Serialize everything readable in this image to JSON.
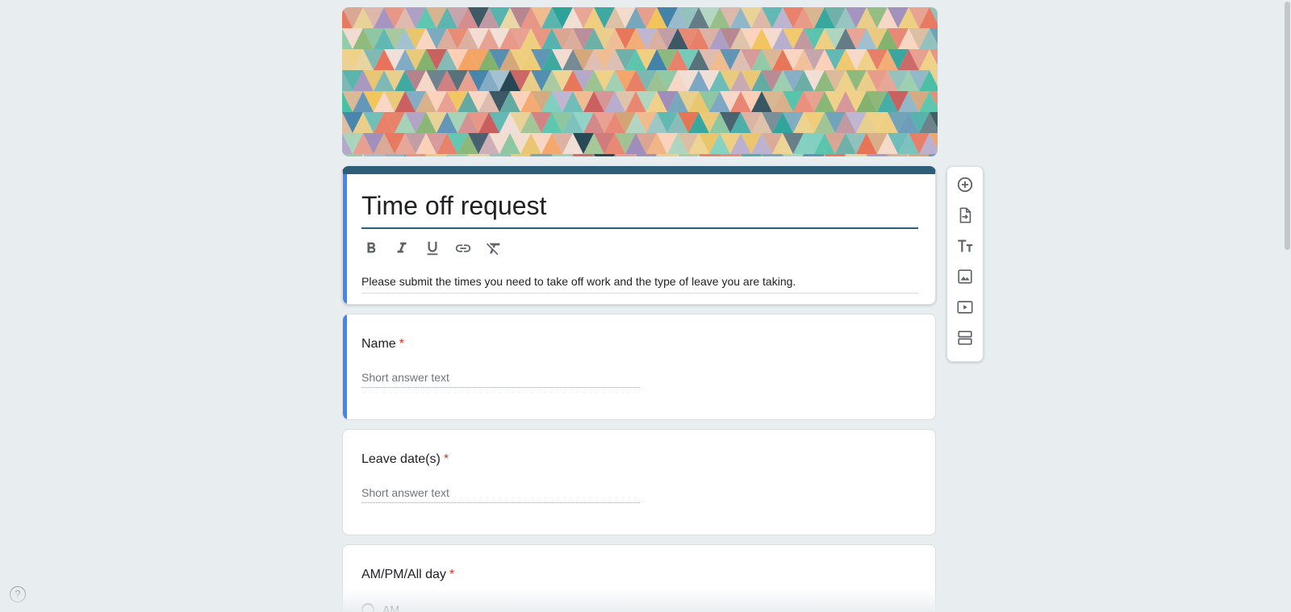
{
  "form": {
    "title": "Time off request",
    "description": "Please submit the times you need to take off work and the type of leave you are taking."
  },
  "format_toolbar": {
    "icons": [
      "bold-icon",
      "italic-icon",
      "underline-icon",
      "link-icon",
      "clear-format-icon"
    ]
  },
  "questions": [
    {
      "label": "Name",
      "required_mark": "*",
      "placeholder": "Short answer text"
    },
    {
      "label": "Leave date(s)",
      "required_mark": "*",
      "placeholder": "Short answer text"
    },
    {
      "label": "AM/PM/All day",
      "required_mark": "*",
      "options": [
        "AM"
      ]
    }
  ],
  "side_toolbar": {
    "icons": [
      "add-question-icon",
      "import-questions-icon",
      "add-title-icon",
      "add-image-icon",
      "add-video-icon",
      "add-section-icon"
    ]
  },
  "help": {
    "label": "?"
  },
  "colors": {
    "background": "#e8edf0",
    "theme": "#2e5e77",
    "active_accent": "#4285f4",
    "required": "#d93025"
  }
}
